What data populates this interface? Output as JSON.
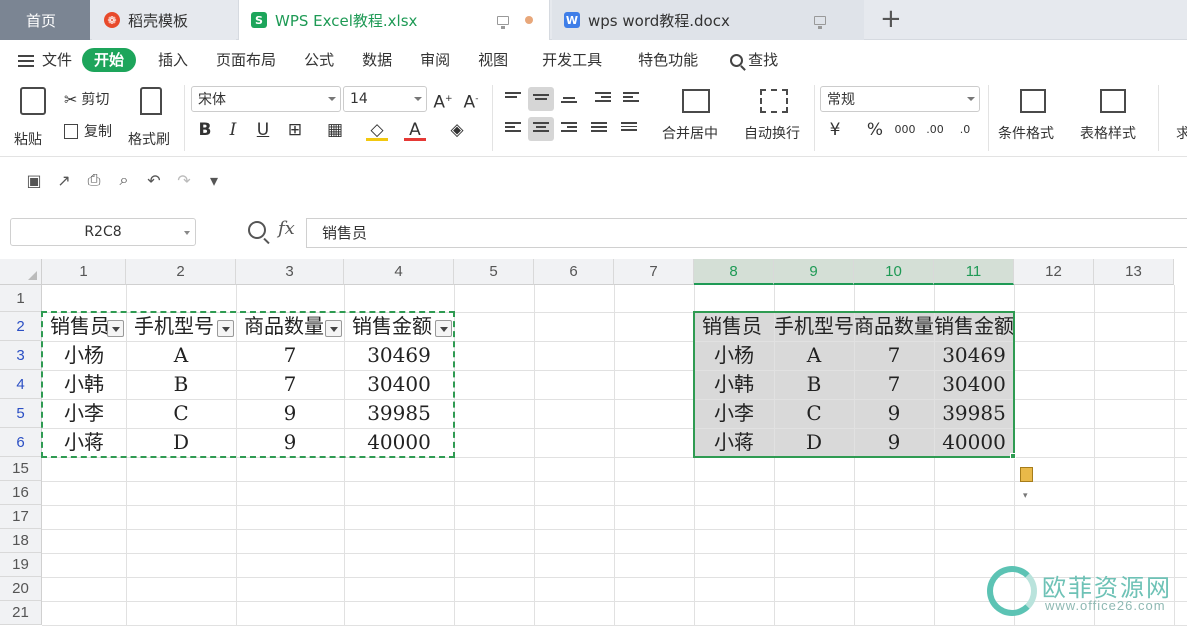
{
  "tabs": {
    "home": "首页",
    "template": "稻壳模板",
    "excel": "WPS Excel教程.xlsx",
    "word": "wps word教程.docx",
    "excel_icon": "S",
    "word_icon": "W",
    "new_tab": "+"
  },
  "menu": {
    "file": "文件",
    "start": "开始",
    "insert": "插入",
    "page_layout": "页面布局",
    "formula": "公式",
    "data": "数据",
    "review": "审阅",
    "view": "视图",
    "dev_tools": "开发工具",
    "features": "特色功能",
    "search": "查找"
  },
  "ribbon": {
    "paste": "粘贴",
    "cut": "剪切",
    "copy": "复制",
    "format_painter": "格式刷",
    "font_name": "宋体",
    "font_size": "14",
    "bold": "B",
    "italic": "I",
    "underline": "U",
    "merge_center": "合并居中",
    "wrap_text": "自动换行",
    "number_format": "常规",
    "percent": "%",
    "cond_format": "条件格式",
    "table_style": "表格样式",
    "sum": "求"
  },
  "formula_bar": {
    "cell_ref": "R2C8",
    "fx": "fx",
    "content": "销售员"
  },
  "columns": [
    "1",
    "2",
    "3",
    "4",
    "5",
    "6",
    "7",
    "8",
    "9",
    "10",
    "11",
    "12",
    "13"
  ],
  "rows": [
    "1",
    "2",
    "3",
    "4",
    "5",
    "6",
    "15",
    "16",
    "17",
    "18",
    "19",
    "20",
    "21"
  ],
  "table_left": {
    "headers": [
      "销售员",
      "手机型号",
      "商品数量",
      "销售金额"
    ],
    "data": [
      [
        "小杨",
        "A",
        "7",
        "30469"
      ],
      [
        "小韩",
        "B",
        "7",
        "30400"
      ],
      [
        "小李",
        "C",
        "9",
        "39985"
      ],
      [
        "小蒋",
        "D",
        "9",
        "40000"
      ]
    ]
  },
  "table_right": {
    "headers": [
      "销售员",
      "手机型号",
      "商品数量",
      "销售金额"
    ],
    "data": [
      [
        "小杨",
        "A",
        "7",
        "30469"
      ],
      [
        "小韩",
        "B",
        "7",
        "30400"
      ],
      [
        "小李",
        "C",
        "9",
        "39985"
      ],
      [
        "小蒋",
        "D",
        "9",
        "40000"
      ]
    ]
  },
  "watermark": {
    "name": "欧菲资源网",
    "url": "www.office26.com"
  },
  "colors": {
    "accent": "#1da55b",
    "selection": "#2f9b52"
  }
}
